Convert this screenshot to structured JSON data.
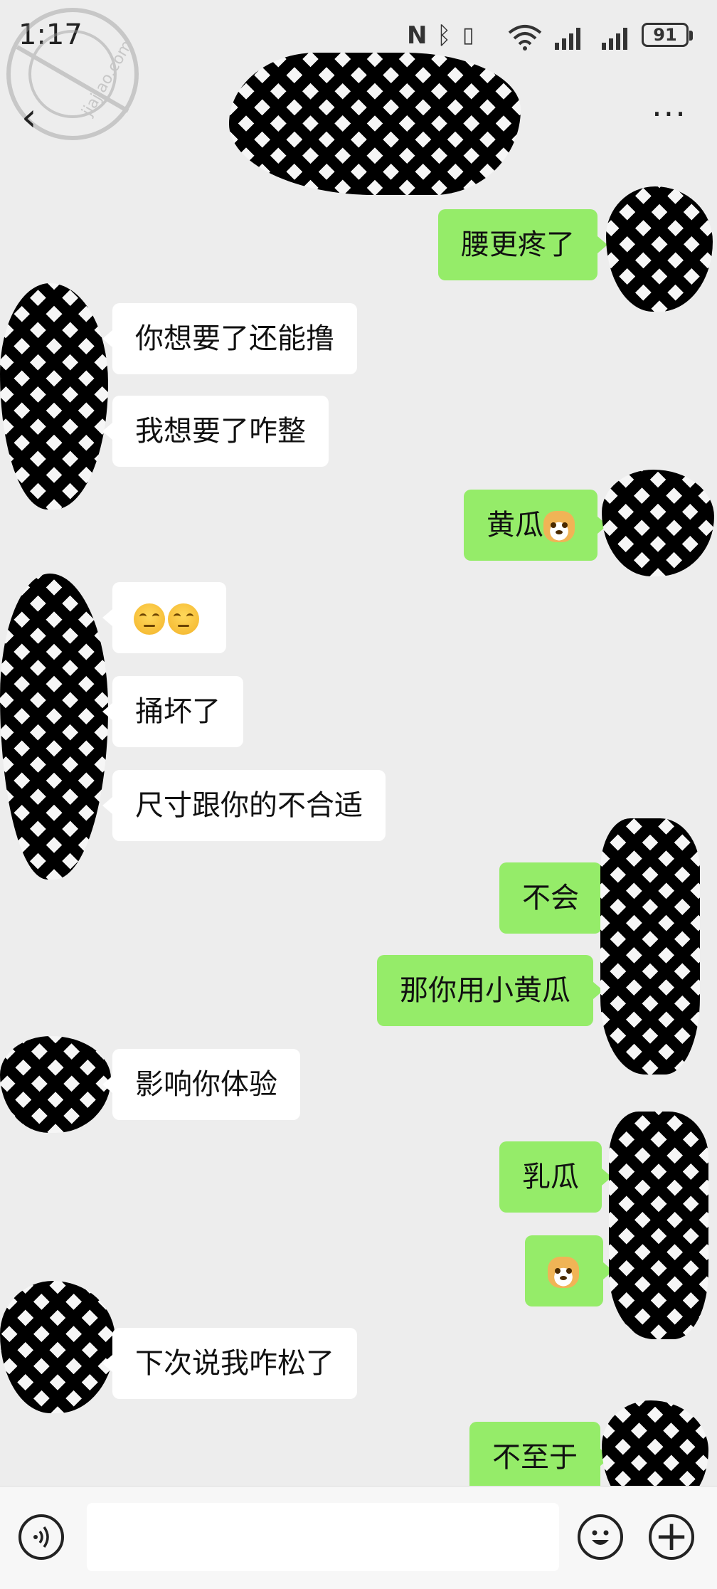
{
  "status": {
    "time": "1:17",
    "battery": "91",
    "icons": [
      "nfc-icon",
      "bluetooth-icon",
      "vibrate-icon",
      "wifi-icon",
      "signal-icon",
      "signal-icon"
    ]
  },
  "watermark": {
    "text": "jiajiao.com",
    "kind": "logo"
  },
  "nav": {
    "back_icon": "chevron-left-icon",
    "more_label": "···",
    "title_redacted": true
  },
  "messages": [
    {
      "side": "sent",
      "text": "腰更疼了"
    },
    {
      "side": "recv",
      "text": "你想要了还能撸"
    },
    {
      "side": "recv",
      "text": "我想要了咋整"
    },
    {
      "side": "sent",
      "text": "黄瓜",
      "emoji": "doge-emoji"
    },
    {
      "side": "recv",
      "text": "",
      "emoji": "eye-roll-emoji x2"
    },
    {
      "side": "recv",
      "text": "捅坏了"
    },
    {
      "side": "recv",
      "text": "尺寸跟你的不合适"
    },
    {
      "side": "sent",
      "text": "不会"
    },
    {
      "side": "sent",
      "text": "那你用小黄瓜"
    },
    {
      "side": "recv",
      "text": "影响你体验"
    },
    {
      "side": "sent",
      "text": "乳瓜"
    },
    {
      "side": "sent",
      "text": "",
      "emoji": "doge-emoji"
    },
    {
      "side": "recv",
      "text": "下次说我咋松了"
    },
    {
      "side": "sent",
      "text": "不至于"
    }
  ],
  "input": {
    "value": "",
    "placeholder": ""
  },
  "colors": {
    "background": "#ededed",
    "sent_bubble": "#95ec69",
    "recv_bubble": "#ffffff"
  }
}
